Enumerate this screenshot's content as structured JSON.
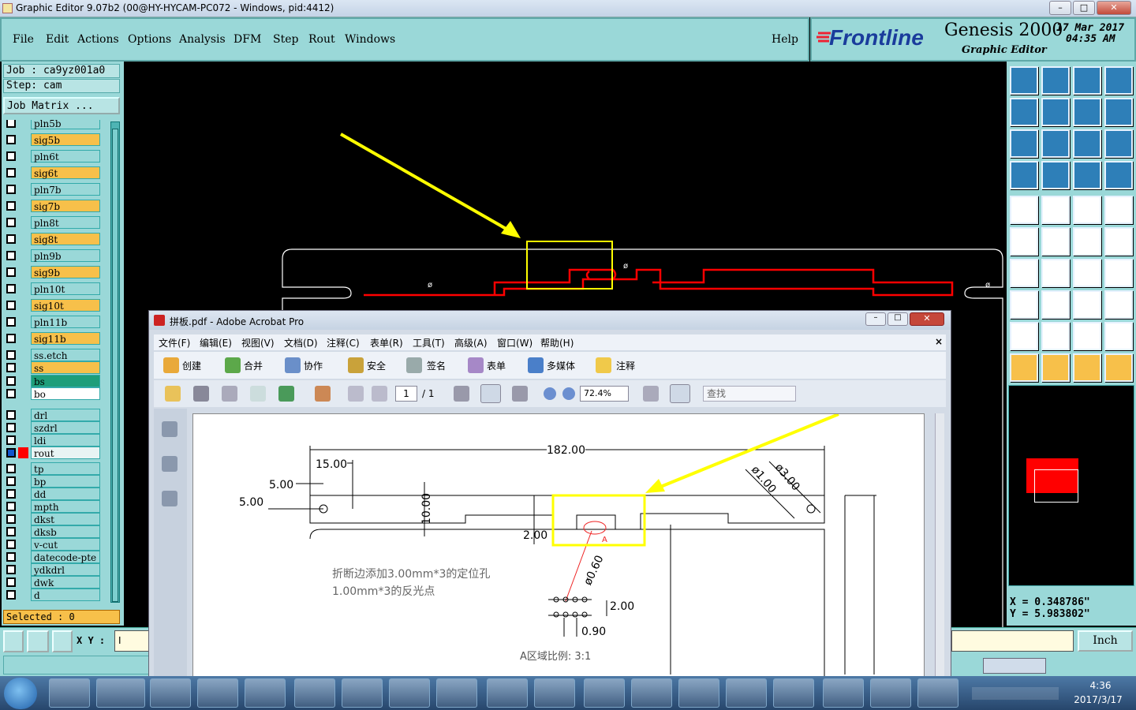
{
  "window": {
    "title": "Graphic Editor 9.07b2 (00@HY-HYCAM-PC072 - Windows, pid:4412)"
  },
  "menu": [
    "File",
    "Edit",
    "Actions",
    "Options",
    "Analysis",
    "DFM",
    "Step",
    "Rout",
    "Windows"
  ],
  "help": "Help",
  "logo": {
    "brand": "Frontline",
    "product": "Genesis 2000",
    "subtitle": "Graphic Editor",
    "date": "17 Mar 2017",
    "time": "04:35 AM"
  },
  "job": {
    "job": "Job : ca9yz001a0",
    "step": "Step: cam",
    "matrix": "Job Matrix ..."
  },
  "layers": {
    "signal": [
      {
        "name": "pln5b",
        "sig": false
      },
      {
        "name": "sig5b",
        "sig": true
      },
      {
        "name": "pln6t",
        "sig": false
      },
      {
        "name": "sig6t",
        "sig": true
      },
      {
        "name": "pln7b",
        "sig": false
      },
      {
        "name": "sig7b",
        "sig": true
      },
      {
        "name": "pln8t",
        "sig": false
      },
      {
        "name": "sig8t",
        "sig": true
      },
      {
        "name": "pln9b",
        "sig": false
      },
      {
        "name": "sig9b",
        "sig": true
      },
      {
        "name": "pln10t",
        "sig": false
      },
      {
        "name": "sig10t",
        "sig": true
      },
      {
        "name": "pln11b",
        "sig": false
      },
      {
        "name": "sig11b",
        "sig": true
      },
      {
        "name": "ss.etch",
        "sig": false
      }
    ],
    "mask": [
      {
        "name": "ss"
      },
      {
        "name": "bs"
      },
      {
        "name": "bo"
      }
    ],
    "drill": [
      {
        "name": "drl"
      },
      {
        "name": "szdrl"
      },
      {
        "name": "ldi"
      },
      {
        "name": "rout"
      }
    ],
    "doc": [
      {
        "name": "tp"
      },
      {
        "name": "bp"
      },
      {
        "name": "dd"
      },
      {
        "name": "mpth"
      },
      {
        "name": "dkst"
      },
      {
        "name": "dksb"
      },
      {
        "name": "v-cut"
      },
      {
        "name": "datecode-pte"
      },
      {
        "name": "ydkdrl"
      },
      {
        "name": "dwk"
      },
      {
        "name": "d"
      }
    ]
  },
  "selected": "Selected : 0",
  "xy": {
    "label": "X Y :",
    "value": "I"
  },
  "coords": {
    "x": "X = 0.348786\"",
    "y": "Y = 5.983802\""
  },
  "units": "Inch",
  "acrobat": {
    "title": "拼板.pdf - Adobe Acrobat Pro",
    "menu": [
      "文件(F)",
      "编辑(E)",
      "视图(V)",
      "文档(D)",
      "注释(C)",
      "表单(R)",
      "工具(T)",
      "高级(A)",
      "窗口(W)",
      "帮助(H)"
    ],
    "tools": [
      "创建",
      "合并",
      "协作",
      "安全",
      "签名",
      "表单",
      "多媒体",
      "注释"
    ],
    "page": "1",
    "pages": "/ 1",
    "zoom": "72.4%",
    "search": "查找",
    "drawing": {
      "dims": [
        "182.00",
        "15.00",
        "5.00",
        "5.00",
        "10.00",
        "2.00",
        "ø1.00",
        "ø3.00",
        "ø0.60",
        "2.00",
        "0.90"
      ],
      "note1": "折断边添加3.00mm*3的定位孔",
      "note2": "1.00mm*3的反光点",
      "scale": "A区域比例: 3:1",
      "marker": "A"
    }
  },
  "taskbar": {
    "time": "4:36",
    "date": "2017/3/17"
  }
}
